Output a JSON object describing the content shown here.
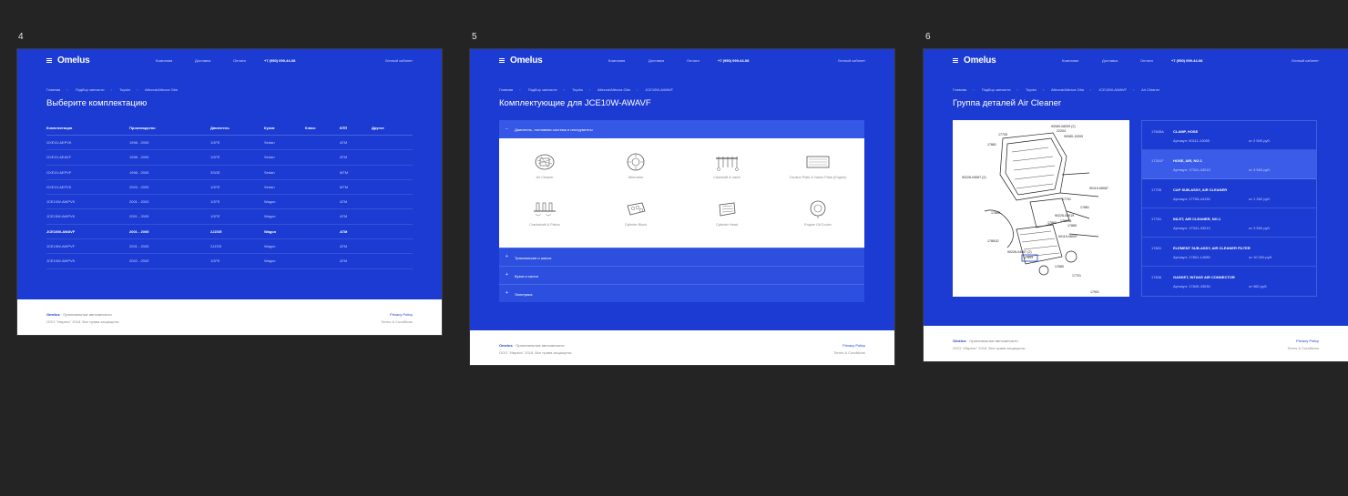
{
  "frames": [
    {
      "number": "4",
      "header": {
        "logo": "Omelus",
        "nav": [
          "Компания",
          "Доставка",
          "Оплата"
        ],
        "phone": "+7 (950) 099-44-08",
        "account": "Личный кабинет"
      },
      "breadcrumbs": [
        "Главная",
        "Подбор запчасти",
        "Toyota",
        "Altezza/Altezza Gita"
      ],
      "title": "Выберите комплектацию",
      "table": {
        "headers": [
          "Комплектация",
          "Производство",
          "Двигатель",
          "Кузов",
          "Класс",
          "КПП",
          "Другое"
        ],
        "rows": [
          [
            "GXE10-AEPVK",
            "1998 - 2005",
            "1GFE",
            "Sedan",
            "",
            "ATM",
            ""
          ],
          [
            "GXE10-AEAVF",
            "1998 - 2005",
            "1GFE",
            "Sedan",
            "",
            "ATM",
            ""
          ],
          [
            "GXE10-AEPVF",
            "1998 - 2005",
            "3SGE",
            "Sedan",
            "",
            "MTM",
            ""
          ],
          [
            "GXE10-AEFVK",
            "2003 - 2005",
            "1GFE",
            "Sedan",
            "",
            "MTM",
            ""
          ],
          [
            "JCE10W-AWPVK",
            "2001 - 2003",
            "1GFE",
            "Wagon",
            "",
            "ATM",
            ""
          ],
          [
            "JCE15W-AWPVK",
            "2001 - 2005",
            "1GFE",
            "Wagon",
            "",
            "ATM",
            ""
          ],
          [
            "JCE10W-AWAVF",
            "2001 - 2005",
            "2JZGE",
            "Wagon",
            "",
            "ATM",
            ""
          ],
          [
            "JCE15W-AWPVF",
            "2001 - 2005",
            "2JZGE",
            "Wagon",
            "",
            "ATM",
            ""
          ],
          [
            "JCE10W-AWPVK",
            "2002 - 2005",
            "1GFE",
            "Wagon",
            "",
            "ATM",
            ""
          ]
        ]
      },
      "footer": {
        "brand": "Omelus",
        "tagline": "· Оригинальные автозапчасти",
        "copy": "ООО \"Имрекс\" 2018. Все права защищены",
        "privacy": "Privacy Policy",
        "terms": "Terms & Conditions"
      }
    },
    {
      "number": "5",
      "header": {
        "logo": "Omelus",
        "nav": [
          "Компания",
          "Доставка",
          "Оплата"
        ],
        "phone": "+7 (950) 099-44-08",
        "account": "Личный кабинет"
      },
      "breadcrumbs": [
        "Главная",
        "Подбор запчасти",
        "Toyota",
        "Altezza/Altezza Gita",
        "JCE10W-AWAVF"
      ],
      "title": "Комплектующие для JCE10W-AWAVF",
      "accordion": {
        "open": {
          "sign": "−",
          "label": "Двигатель, топливная система и инструменты"
        },
        "parts": [
          "Air Cleaner",
          "Alternator",
          "Camshaft & valve",
          "Caution Plate & Name Plate (Engine)",
          "Crankshaft & Piston",
          "Cylinder Block",
          "Cylinder Head",
          "Engine Oil Cooler"
        ],
        "closed": [
          {
            "sign": "+",
            "label": "Трансмиссия и шасси"
          },
          {
            "sign": "+",
            "label": "Кузов и салон"
          },
          {
            "sign": "+",
            "label": "Электрика"
          }
        ]
      },
      "footer": {
        "brand": "Omelus",
        "tagline": "· Оригинальные автозапчасти",
        "copy": "ООО \"Имрекс\" 2018. Все права защищены",
        "privacy": "Privacy Policy",
        "terms": "Terms & Conditions"
      }
    },
    {
      "number": "6",
      "header": {
        "logo": "Omelus",
        "nav": [
          "Компания",
          "Доставка",
          "Оплата"
        ],
        "phone": "+7 (950) 099-44-08",
        "account": "Личный кабинет"
      },
      "breadcrumbs": [
        "Главная",
        "Подбор запчасти",
        "Toyota",
        "Altezza/Altezza Gita",
        "JCE10W-AWAVF",
        "Air Cleaner"
      ],
      "title": "Группа деталей Air Cleaner",
      "diagram_labels": [
        "90080-08209 (2)",
        "22204",
        "17705",
        "17881",
        "90080-13200",
        "90226-04087 (2)",
        "17751",
        "90119-08087",
        "17881",
        "17880",
        "90226-04019",
        "17881D",
        "17881B",
        "17880",
        "17885",
        "90119-08097",
        "17893",
        "90226-04087 (2)",
        "17680",
        "17701",
        "17901"
      ],
      "parts": [
        {
          "num": "17845A",
          "name": "CLAMP, HOSE",
          "article": "Артикул: 90111-13050",
          "price": "от 2 500 руб."
        },
        {
          "num": "17341F",
          "name": "HOSE, AIR, NO.1",
          "article": "Артикул: 17341-43210",
          "price": "от 3 560 руб."
        },
        {
          "num": "17705",
          "name": "CAP SUB-ASSY, AIR CLEANER",
          "article": "Артикул: 17705-44130",
          "price": "от 1 262 руб."
        },
        {
          "num": "17761",
          "name": "INLET, AIR CLEANER, NO.1",
          "article": "Артикул: 17341-43210",
          "price": "от 3 560 руб."
        },
        {
          "num": "17801",
          "name": "ELEMENT SUB-ASSY, AIR CLEANER FILTER",
          "article": "Артикул: 17801-14080",
          "price": "от 10 000 руб."
        },
        {
          "num": "17846",
          "name": "GASKET, INTAKE AIR CONNECTOR",
          "article": "Артикул: 17849-43030",
          "price": "от 960 руб."
        }
      ],
      "footer": {
        "brand": "Omelus",
        "tagline": "· Оригинальные автозапчасти",
        "copy": "ООО \"Имрекс\" 2018. Все права защищены",
        "privacy": "Privacy Policy",
        "terms": "Terms & Conditions"
      }
    }
  ]
}
